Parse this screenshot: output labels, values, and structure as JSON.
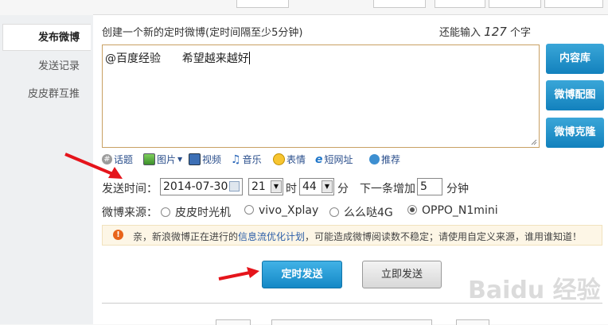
{
  "sidebar": {
    "items": [
      {
        "label": "发布微博"
      },
      {
        "label": "发送记录"
      },
      {
        "label": "皮皮群互推"
      }
    ]
  },
  "compose": {
    "hint": "创建一个新的定时微博(定时间隔至少5分钟)",
    "counter_prefix": "还能输入",
    "counter_value": "127",
    "counter_suffix": "个字",
    "content": "@百度经验      希望越来越好"
  },
  "side_buttons": [
    "内容库",
    "微博配图",
    "微博克隆"
  ],
  "toolbar": {
    "items": [
      {
        "label": "话题",
        "icon": "topic-icon"
      },
      {
        "label": "图片",
        "icon": "picture-icon"
      },
      {
        "label": "视频",
        "icon": "video-icon"
      },
      {
        "label": "音乐",
        "icon": "music-icon"
      },
      {
        "label": "表情",
        "icon": "emotion-icon"
      },
      {
        "label": "短网址",
        "icon": "short-url-icon"
      },
      {
        "label": "推荐",
        "icon": "recommend-icon"
      }
    ]
  },
  "schedule": {
    "label": "发送时间：",
    "date": "2014-07-30",
    "hour": "21",
    "hour_unit": "时",
    "minute": "44",
    "minute_unit": "分",
    "next_label": "下一条增加",
    "next_value": "5",
    "next_unit": "分钟"
  },
  "source": {
    "label": "微博来源：",
    "options": [
      "皮皮时光机",
      "vivo_Xplay",
      "么么哒4G",
      "OPPO_N1mini"
    ],
    "selected": "OPPO_N1mini"
  },
  "notice": {
    "prefix": "亲，新浪微博正在进行的",
    "link": "信息流优化计划",
    "suffix": "，可能造成微博阅读数不稳定；请使用自定义来源，谁用谁知道！"
  },
  "actions": {
    "schedule_send": "定时发送",
    "send_now": "立即发送"
  },
  "watermark": "Baidu 经验",
  "colors": {
    "primary": "#1488c6",
    "arrow": "#e5141b",
    "notice_bg": "#fdf6e6",
    "notice_icon": "#e8641b",
    "textarea_border": "#c8a063"
  }
}
